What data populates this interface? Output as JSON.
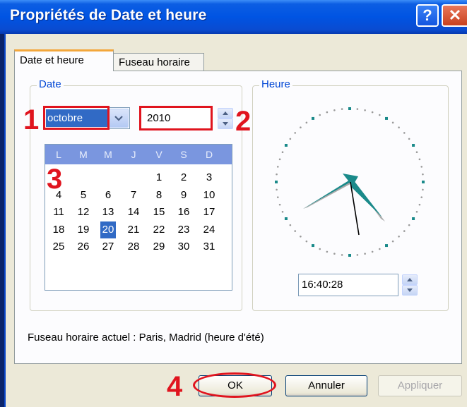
{
  "window": {
    "title": "Propriétés de Date et heure",
    "help_label": "?",
    "close_label": "✕"
  },
  "tabs": [
    {
      "label": "Date et heure",
      "active": true
    },
    {
      "label": "Fuseau horaire",
      "active": false
    }
  ],
  "date_group": {
    "title": "Date",
    "month": "octobre",
    "year": "2010",
    "weekdays": [
      "L",
      "M",
      "M",
      "J",
      "V",
      "S",
      "D"
    ],
    "weeks": [
      [
        "",
        "",
        "",
        "",
        "1",
        "2",
        "3"
      ],
      [
        "4",
        "5",
        "6",
        "7",
        "8",
        "9",
        "10"
      ],
      [
        "11",
        "12",
        "13",
        "14",
        "15",
        "16",
        "17"
      ],
      [
        "18",
        "19",
        "20",
        "21",
        "22",
        "23",
        "24"
      ],
      [
        "25",
        "26",
        "27",
        "28",
        "29",
        "30",
        "31"
      ]
    ],
    "selected_day": "20"
  },
  "time_group": {
    "title": "Heure",
    "time": "16:40:28"
  },
  "timezone_text": "Fuseau horaire actuel : Paris, Madrid (heure d'été)",
  "buttons": {
    "ok": "OK",
    "cancel": "Annuler",
    "apply": "Appliquer"
  },
  "annotations": {
    "a1": "1",
    "a2": "2",
    "a3": "3",
    "a4": "4"
  },
  "colors": {
    "annotation": "#e0141e",
    "selection": "#316ac5",
    "title_bar": "#0054e3",
    "clock_hands": "#1a8a8a"
  }
}
